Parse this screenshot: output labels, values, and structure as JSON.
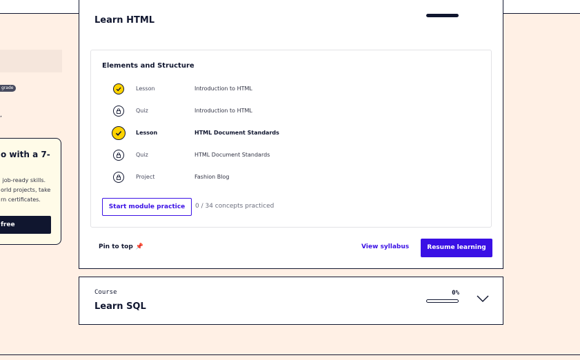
{
  "left_panel": {
    "upgrade_badge": "grade",
    "trial": {
      "title": "o with a 7-",
      "description": " job-ready skills.\norld projects, take\nrn certificates.",
      "button_label": "free"
    }
  },
  "courses": [
    {
      "title": "Learn HTML",
      "module": {
        "title": "Elements and Structure",
        "items": [
          {
            "kind": "Lesson",
            "name": "Introduction to HTML",
            "status": "complete",
            "icon": "check-icon"
          },
          {
            "kind": "Quiz",
            "name": "Introduction to HTML",
            "status": "locked",
            "icon": "lock-icon"
          },
          {
            "kind": "Lesson",
            "name": "HTML Document Standards",
            "status": "current",
            "icon": "check-icon"
          },
          {
            "kind": "Quiz",
            "name": "HTML Document Standards",
            "status": "locked",
            "icon": "lock-icon"
          },
          {
            "kind": "Project",
            "name": "Fashion Blog",
            "status": "locked",
            "icon": "lock-icon"
          }
        ],
        "practice_button": "Start module practice",
        "practice_status": "0 / 34 concepts practiced"
      },
      "pin_label": "Pin to top",
      "pin_icon": "pin-icon",
      "syllabus_link": "View syllabus",
      "resume_button": "Resume learning"
    },
    {
      "label": "Course",
      "title": "Learn SQL",
      "progress_text": "0%",
      "progress": 0,
      "expand_icon": "chevron-down-icon"
    }
  ],
  "colors": {
    "background": "#fff0e5",
    "accent": "#3a10e5",
    "complete": "#ffd300",
    "ink": "#10162f"
  }
}
